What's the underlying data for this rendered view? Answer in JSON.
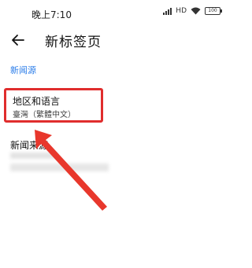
{
  "status_bar": {
    "time": "晚上7:10",
    "battery": "100",
    "network_badge": "HD"
  },
  "header": {
    "title": "新标签页"
  },
  "section": {
    "label": "新闻源"
  },
  "settings": {
    "region": {
      "title": "地区和语言",
      "value": "臺灣（繁體中文）"
    },
    "news_source": {
      "title": "新闻来源"
    }
  },
  "colors": {
    "accent": "#2b7de9",
    "highlight": "#e02d2d"
  }
}
